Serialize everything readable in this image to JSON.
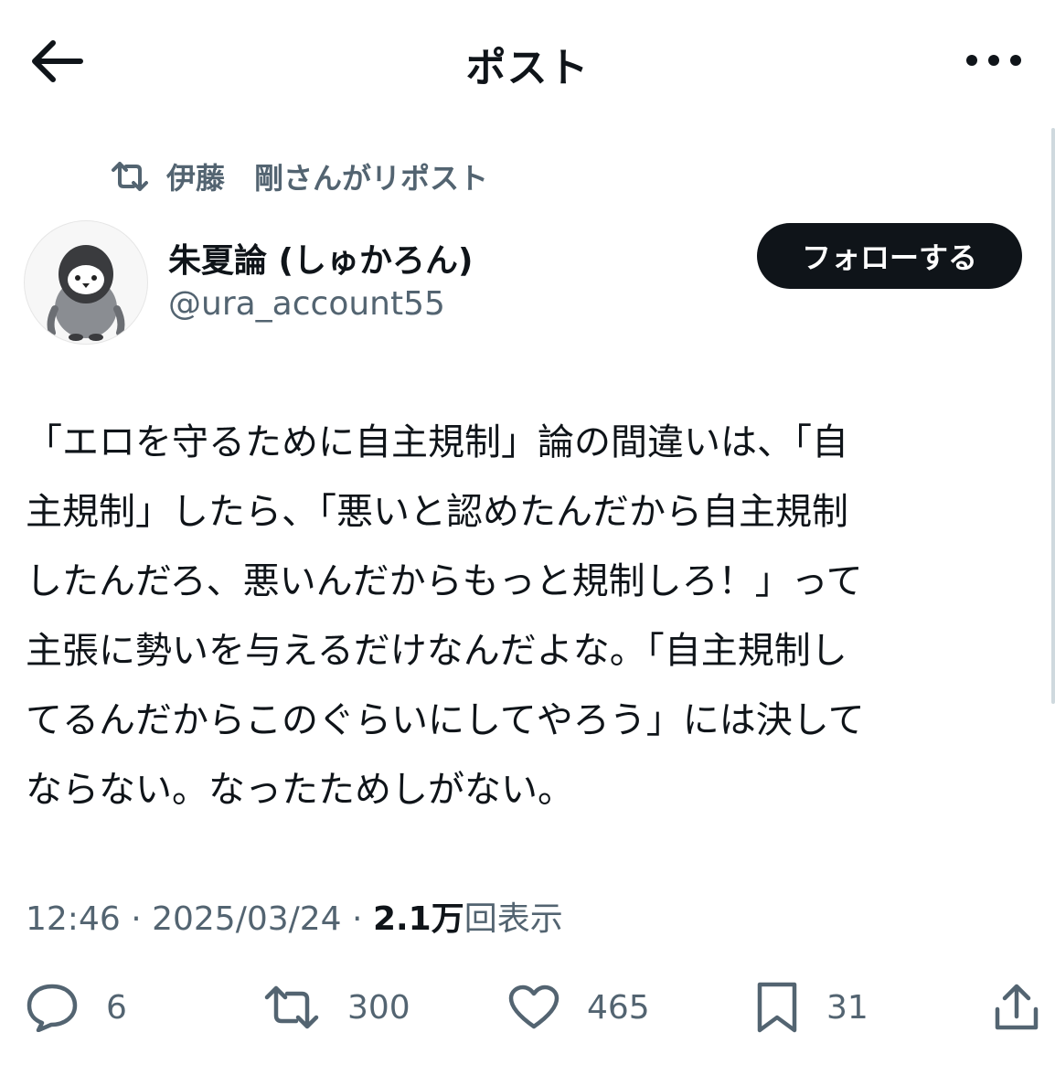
{
  "header": {
    "title": "ポスト"
  },
  "repost": {
    "text": "伊藤　剛さんがリポスト"
  },
  "author": {
    "name": "朱夏論 (しゅかろん)",
    "handle": "@ura_account55"
  },
  "follow_label": "フォローする",
  "tweet": {
    "lines": [
      "「エロを守るために自主規制」論の間違いは、「自",
      "主規制」したら、「悪いと認めたんだから自主規制",
      "したんだろ、悪いんだからもっと規制しろ！」って",
      "主張に勢いを与えるだけなんだよな。「自主規制し",
      "てるんだからこのぐらいにしてやろう」には決して",
      "ならない。なったためしがない。"
    ]
  },
  "meta": {
    "time": "12:46",
    "sep": " · ",
    "date": "2025/03/24",
    "views_count": "2.1万",
    "views_label": "回表示"
  },
  "actions": {
    "replies": "6",
    "reposts": "300",
    "likes": "465",
    "bookmarks": "31"
  },
  "colors": {
    "text": "#0f1419",
    "secondary": "#536471",
    "button_bg": "#0f1419"
  }
}
